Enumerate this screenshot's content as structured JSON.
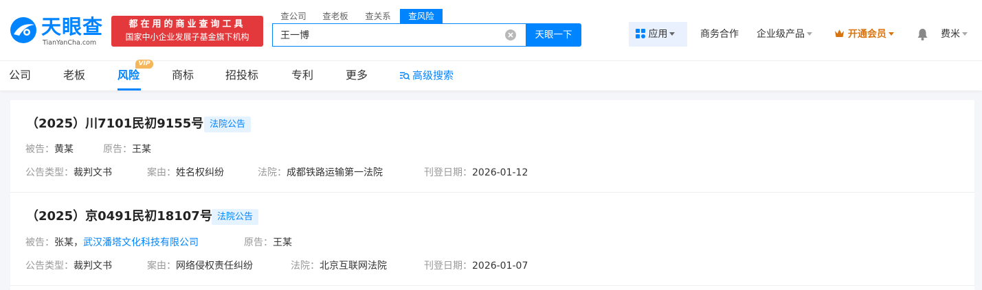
{
  "header": {
    "logo_cn": "天眼查",
    "logo_en": "TianYanCha.com",
    "slogan_line1": "都在用的商业查询工具",
    "slogan_line2": "国家中小企业发展子基金旗下机构",
    "search_tabs": [
      {
        "label": "查公司",
        "active": false
      },
      {
        "label": "查老板",
        "active": false
      },
      {
        "label": "查关系",
        "active": false
      },
      {
        "label": "查风险",
        "active": true
      }
    ],
    "search_value": "王一博",
    "search_button": "天眼一下",
    "app_button": "应用",
    "business": "商务合作",
    "enterprise": "企业级产品",
    "vip_open": "开通会员",
    "user": "费米"
  },
  "category_nav": {
    "items": [
      "公司",
      "老板",
      "风险",
      "商标",
      "招投标",
      "专利",
      "更多"
    ],
    "active": "风险",
    "vip_badge": "VIP",
    "advanced_search": "高级搜索"
  },
  "results": [
    {
      "case_no": "（2025）川7101民初9155号",
      "tag": "法院公告",
      "defendant_label": "被告：",
      "defendants": [
        {
          "text": "黄某",
          "link": false
        }
      ],
      "plaintiff_label": "原告：",
      "plaintiff": "王某",
      "type_label": "公告类型：",
      "type": "裁判文书",
      "cause_label": "案由：",
      "cause": "姓名权纠纷",
      "court_label": "法院：",
      "court": "成都铁路运输第一法院",
      "date_label": "刊登日期：",
      "date": "2026-01-12"
    },
    {
      "case_no": "（2025）京0491民初18107号",
      "tag": "法院公告",
      "defendant_label": "被告：",
      "defendants": [
        {
          "text": "张某，",
          "link": false
        },
        {
          "text": "武汉潘塔文化科技有限公司",
          "link": true
        }
      ],
      "plaintiff_label": "原告：",
      "plaintiff": "王某",
      "type_label": "公告类型：",
      "type": "裁判文书",
      "cause_label": "案由：",
      "cause": "网络侵权责任纠纷",
      "court_label": "法院：",
      "court": "北京互联网法院",
      "date_label": "刊登日期：",
      "date": "2026-01-07"
    }
  ],
  "colors": {
    "brand": "#0084ff",
    "slogan_bg": "#e4393c",
    "vip": "#d8740f",
    "tag_bg": "#e5f2ff"
  },
  "icons": [
    "tianyancha-logo-icon",
    "clear-icon",
    "apps-grid-icon",
    "crown-icon",
    "bell-icon",
    "advanced-search-icon"
  ]
}
